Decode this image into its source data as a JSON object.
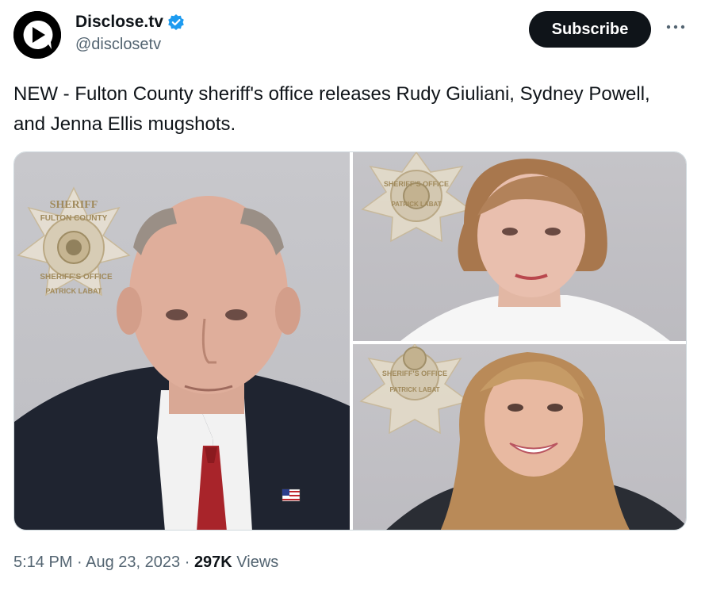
{
  "author": {
    "display_name": "Disclose.tv",
    "handle": "@disclosetv",
    "verified_icon": "verified-badge-icon",
    "avatar_icon": "disclose-logo-icon"
  },
  "actions": {
    "subscribe_label": "Subscribe",
    "more_icon": "more-dots-icon"
  },
  "tweet": {
    "text": "NEW - Fulton County sheriff's office releases Rudy Giuliani, Sydney Powell, and Jenna Ellis mugshots."
  },
  "media": {
    "photos": [
      {
        "badge_top": "SHERIFF",
        "badge_ring": "FULTON COUNTY",
        "badge_lower": "SHERIFF'S OFFICE",
        "badge_bottom": "PATRICK LABAT"
      },
      {
        "badge_lower": "SHERIFF'S OFFICE",
        "badge_bottom": "PATRICK LABAT"
      },
      {
        "badge_lower": "SHERIFF'S OFFICE",
        "badge_bottom": "PATRICK LABAT"
      }
    ]
  },
  "meta": {
    "time": "5:14 PM",
    "separator": " · ",
    "date": "Aug 23, 2023",
    "views_count": "297K",
    "views_label": " Views"
  },
  "colors": {
    "text_primary": "#0f1419",
    "text_secondary": "#536471",
    "verified_blue": "#1d9bf0",
    "subscribe_bg": "#0f1419"
  }
}
